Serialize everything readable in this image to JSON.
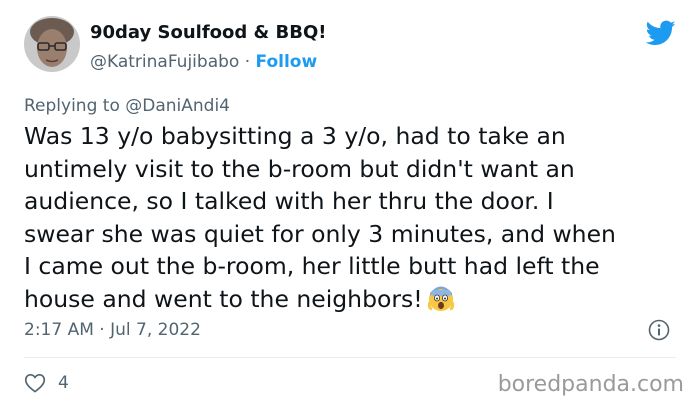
{
  "author": {
    "display_name": "90day Soulfood & BBQ!",
    "handle": "@KatrinaFujibabo",
    "separator": "·",
    "follow_label": "Follow"
  },
  "reply": {
    "prefix": "Replying to",
    "mention": "@DaniAndi4"
  },
  "tweet": {
    "lines": [
      "Was 13 y/o babysitting a 3 y/o, had to take an",
      "untimely visit to the b-room but didn't want an",
      "audience, so I talked with her thru the door. I",
      "swear she was quiet for only 3 minutes, and when",
      "I came out the b-room, her little butt had left the",
      "house and went to the neighbors!"
    ],
    "emoji": "face-screaming-in-fear"
  },
  "meta": {
    "time": "2:17 AM",
    "separator": "·",
    "date": "Jul 7, 2022"
  },
  "engagement": {
    "likes": "4"
  },
  "watermark": "boredpanda.com",
  "colors": {
    "accent": "#1d9bf0",
    "secondary_text": "#536471",
    "primary_text": "#0f1419"
  }
}
